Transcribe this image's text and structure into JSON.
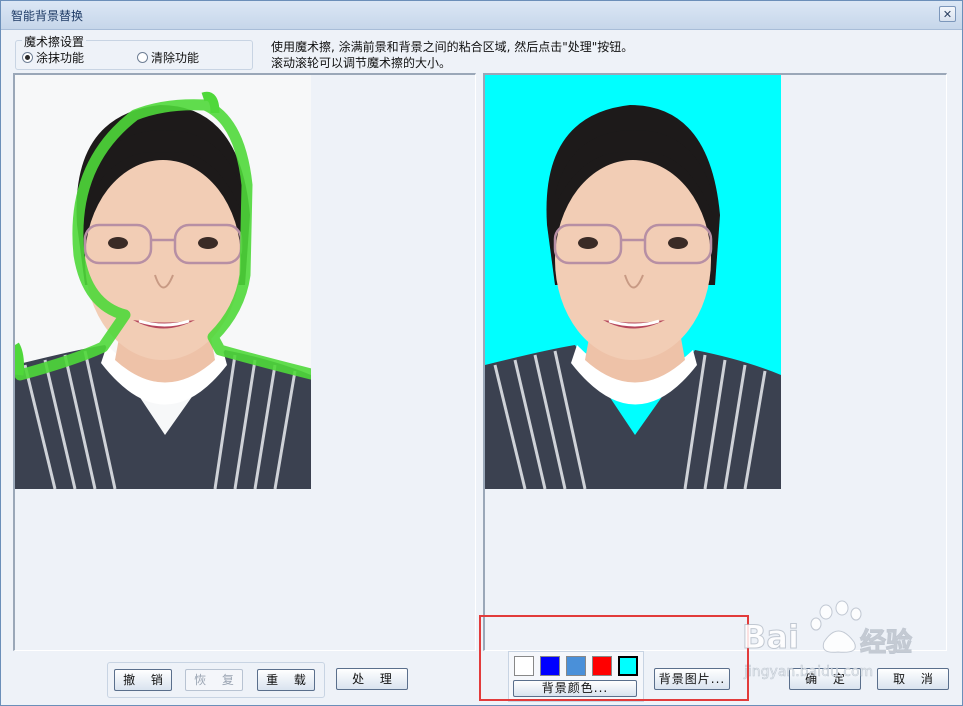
{
  "window": {
    "title": "智能背景替换",
    "close_glyph": "✕"
  },
  "brush_settings": {
    "group_title": "魔术擦设置",
    "options": [
      {
        "label": "涂抹功能",
        "selected": true
      },
      {
        "label": "清除功能",
        "selected": false
      }
    ]
  },
  "instructions": {
    "line1": "使用魔术擦, 涂满前景和背景之间的粘合区域, 然后点击\"处理\"按钮。",
    "line2": "滚动滚轮可以调节魔术擦的大小。"
  },
  "edit_buttons": {
    "undo": "撤 销",
    "redo": "恢 复",
    "reload": "重 载"
  },
  "process_button": "处 理",
  "background": {
    "swatches": [
      "#ffffff",
      "#0000ff",
      "#4a90d9",
      "#ff0000",
      "#00ffff"
    ],
    "selected_index": 4,
    "color_button": "背景颜色...",
    "image_button": "背景图片..."
  },
  "dialog_buttons": {
    "ok": "确 定",
    "cancel": "取 消"
  },
  "preview_background": "#00ffff",
  "watermark": {
    "brand": "Bai",
    "brand_cn": "经验",
    "url": "jingyan.baidu.com"
  }
}
